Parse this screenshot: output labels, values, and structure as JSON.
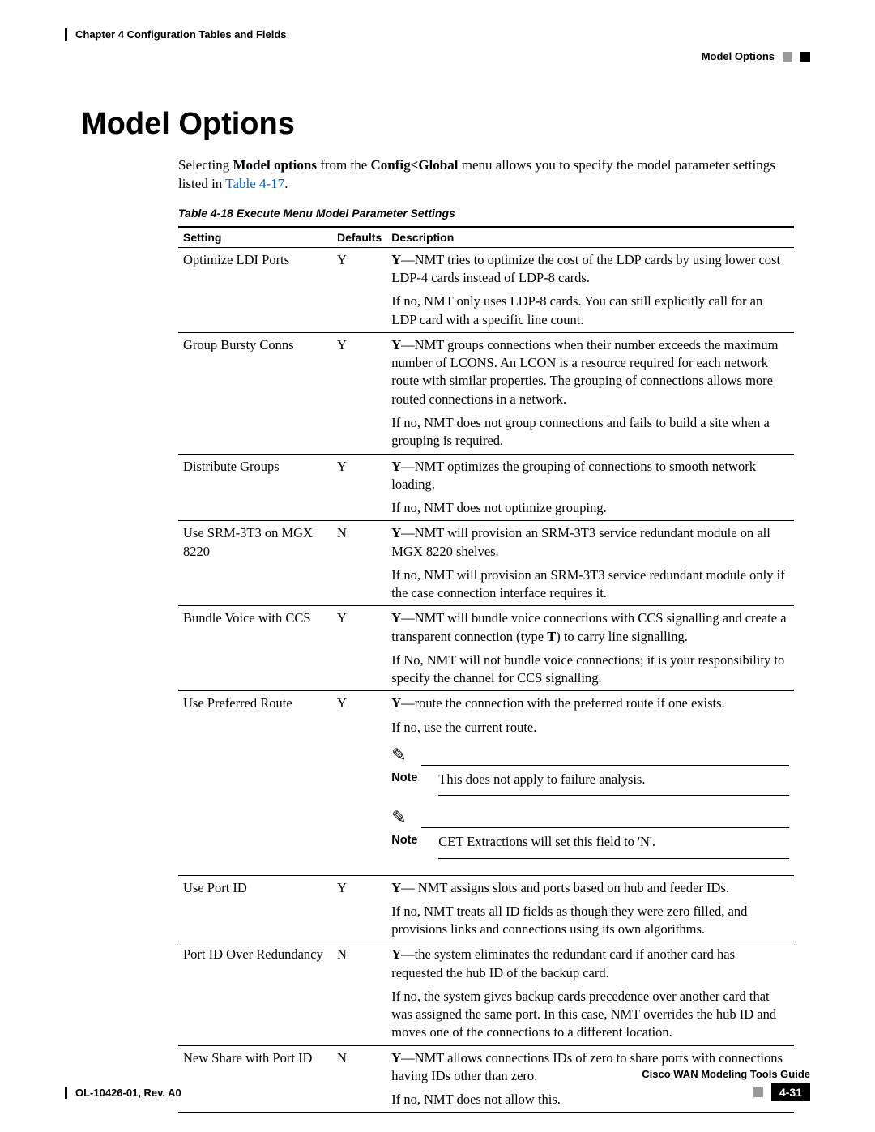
{
  "header": {
    "chapter": "Chapter 4    Configuration Tables and Fields",
    "section": "Model Options"
  },
  "title": "Model Options",
  "intro": {
    "pre": "Selecting ",
    "bold1": "Model options",
    "mid1": " from the ",
    "bold2": "Config<Global",
    "mid2": " menu allows you to specify the model parameter settings listed in ",
    "link": "Table 4-17",
    "post": "."
  },
  "caption": "Table 4-18   Execute Menu Model Parameter Settings",
  "columns": {
    "setting": "Setting",
    "defaults": "Defaults",
    "description": "Description"
  },
  "rows": [
    {
      "setting": "Optimize LDI Ports",
      "default": "Y",
      "parts": [
        {
          "lead": "Y",
          "text": "—NMT tries to optimize the cost of the LDP cards by using lower cost LDP-4 cards instead of LDP-8 cards."
        },
        {
          "text": "If no, NMT only uses LDP-8 cards. You can still explicitly call for an LDP card with a specific line count."
        }
      ]
    },
    {
      "setting": "Group Bursty Conns",
      "default": "Y",
      "parts": [
        {
          "lead": "Y",
          "text": "—NMT groups connections when their number exceeds the maximum number of LCONS. An LCON is a resource required for each network route with similar properties. The grouping of connections allows more routed connections in a network."
        },
        {
          "text": "If no, NMT does not group connections and fails to build a site when a grouping is required."
        }
      ]
    },
    {
      "setting": "Distribute Groups",
      "default": "Y",
      "parts": [
        {
          "lead": "Y",
          "text": "—NMT optimizes the grouping of connections to smooth network loading."
        },
        {
          "text": "If no, NMT does not optimize grouping."
        }
      ]
    },
    {
      "setting": "Use SRM-3T3 on MGX 8220",
      "default": "N",
      "parts": [
        {
          "lead": "Y",
          "text": "—NMT will provision an SRM-3T3 service redundant module on all MGX 8220 shelves."
        },
        {
          "text": "If no, NMT will provision an SRM-3T3 service redundant module only if the case connection interface requires it."
        }
      ]
    },
    {
      "setting": "Bundle Voice with CCS",
      "default": "Y",
      "parts": [
        {
          "lead": "Y",
          "text1": "—NMT will bundle voice connections with CCS signalling and create a transparent connection (type ",
          "bold": "T",
          "text2": ") to carry line signalling."
        },
        {
          "text": "If No, NMT will not bundle voice connections; it is your responsibility to specify the channel for CCS signalling."
        }
      ]
    },
    {
      "setting": "Use Preferred Route",
      "default": "Y",
      "parts": [
        {
          "lead": "Y",
          "text": "—route the connection with the preferred route if one exists."
        },
        {
          "text": "If no, use the current route."
        }
      ],
      "notes": [
        "This does not apply to failure analysis.",
        "CET Extractions will set this field to 'N'."
      ]
    },
    {
      "setting": "Use Port ID",
      "default": "Y",
      "parts": [
        {
          "lead": "Y",
          "text": "— NMT assigns slots and ports based on hub and feeder IDs."
        },
        {
          "text": "If no, NMT treats all ID fields as though they were zero filled, and provisions links and connections using its own algorithms."
        }
      ]
    },
    {
      "setting": "Port ID Over Redundancy",
      "default": "N",
      "parts": [
        {
          "lead": "Y",
          "text": "—the system eliminates the redundant card if another card has requested the hub ID of the backup card."
        },
        {
          "text": "If no, the system gives backup cards precedence over another card that was assigned the same port. In this case, NMT overrides the hub ID and moves one of the connections to a different location."
        }
      ]
    },
    {
      "setting": "New Share with Port ID",
      "default": "N",
      "parts": [
        {
          "lead": "Y",
          "text": "—NMT allows connections IDs of zero to share ports with connections having IDs other than zero."
        },
        {
          "text": "If no, NMT does not allow this."
        }
      ]
    }
  ],
  "note_label": "Note",
  "footer": {
    "guide": "Cisco WAN Modeling Tools Guide",
    "docid": "OL-10426-01, Rev. A0",
    "page": "4-31"
  }
}
